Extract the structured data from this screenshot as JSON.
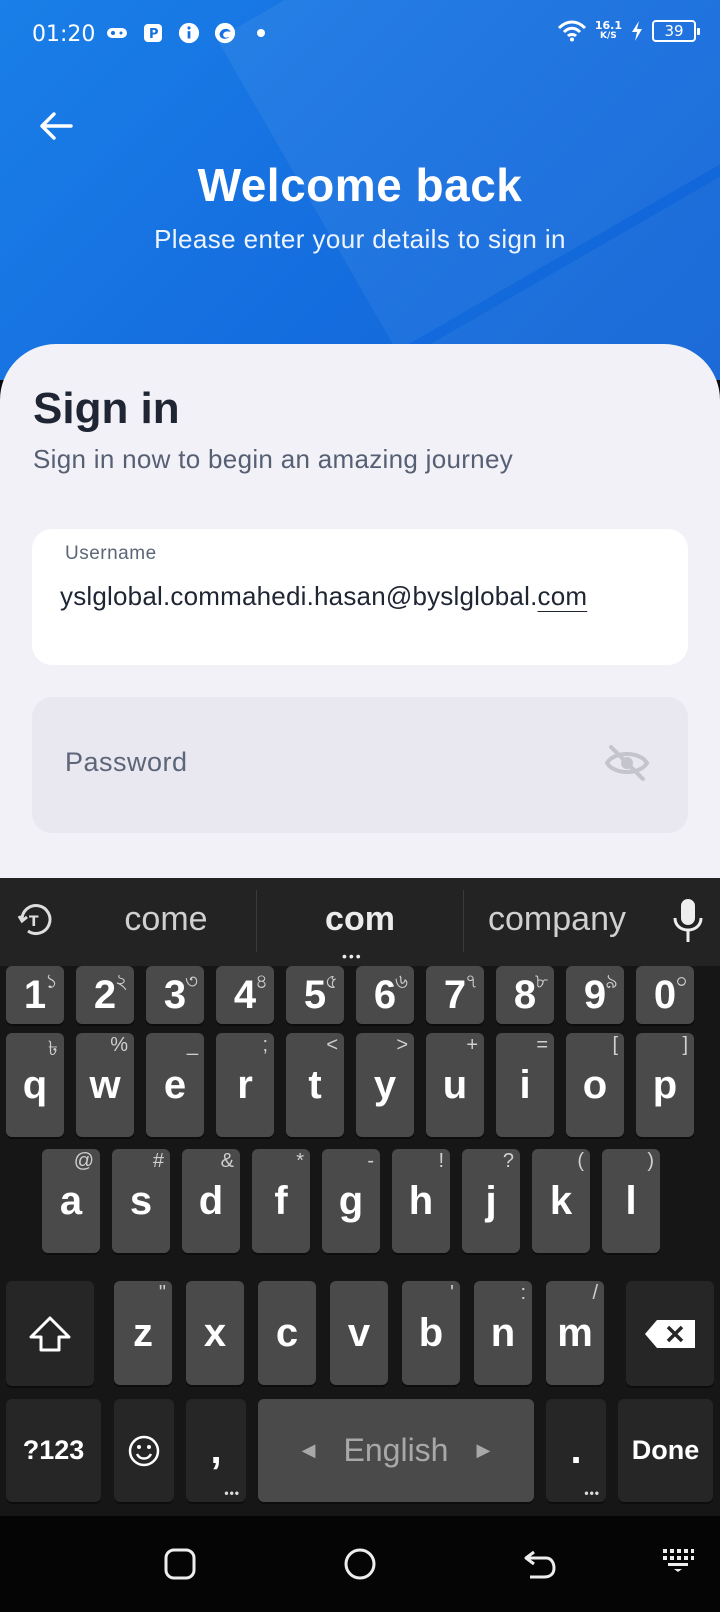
{
  "status_bar": {
    "time": "01:20",
    "net_speed_value": "16.1",
    "net_speed_unit": "K/S",
    "battery": "39"
  },
  "header": {
    "title": "Welcome back",
    "subtitle": "Please enter your details to sign in"
  },
  "signin": {
    "title": "Sign in",
    "subtitle": "Sign in now to begin an amazing journey",
    "username_label": "Username",
    "username_value_main": "yslglobal.commahedi.hasan@byslglobal.",
    "username_value_composing": "com",
    "password_placeholder": "Password"
  },
  "keyboard": {
    "suggestions": [
      "come",
      "com",
      "company"
    ],
    "row_numbers": [
      {
        "k": "1",
        "h": "১"
      },
      {
        "k": "2",
        "h": "২"
      },
      {
        "k": "3",
        "h": "৩"
      },
      {
        "k": "4",
        "h": "৪"
      },
      {
        "k": "5",
        "h": "৫"
      },
      {
        "k": "6",
        "h": "৬"
      },
      {
        "k": "7",
        "h": "৭"
      },
      {
        "k": "8",
        "h": "৮"
      },
      {
        "k": "9",
        "h": "৯"
      },
      {
        "k": "0",
        "h": "০"
      }
    ],
    "row_q": [
      {
        "k": "q",
        "h": "৳"
      },
      {
        "k": "w",
        "h": "%"
      },
      {
        "k": "e",
        "h": "_"
      },
      {
        "k": "r",
        "h": ";"
      },
      {
        "k": "t",
        "h": "<"
      },
      {
        "k": "y",
        "h": ">"
      },
      {
        "k": "u",
        "h": "+"
      },
      {
        "k": "i",
        "h": "="
      },
      {
        "k": "o",
        "h": "["
      },
      {
        "k": "p",
        "h": "]"
      }
    ],
    "row_a": [
      {
        "k": "a",
        "h": "@"
      },
      {
        "k": "s",
        "h": "#"
      },
      {
        "k": "d",
        "h": "&"
      },
      {
        "k": "f",
        "h": "*"
      },
      {
        "k": "g",
        "h": "-"
      },
      {
        "k": "h",
        "h": "!"
      },
      {
        "k": "j",
        "h": "?"
      },
      {
        "k": "k",
        "h": "("
      },
      {
        "k": "l",
        "h": ")"
      }
    ],
    "row_z": [
      {
        "k": "z",
        "h": "\""
      },
      {
        "k": "x",
        "h": ""
      },
      {
        "k": "c",
        "h": ""
      },
      {
        "k": "v",
        "h": ""
      },
      {
        "k": "b",
        "h": "'"
      },
      {
        "k": "n",
        "h": ":"
      },
      {
        "k": "m",
        "h": "/"
      }
    ],
    "symbols_label": "?123",
    "comma_label": ",",
    "space_label": "English",
    "period_label": ".",
    "done_label": "Done"
  }
}
